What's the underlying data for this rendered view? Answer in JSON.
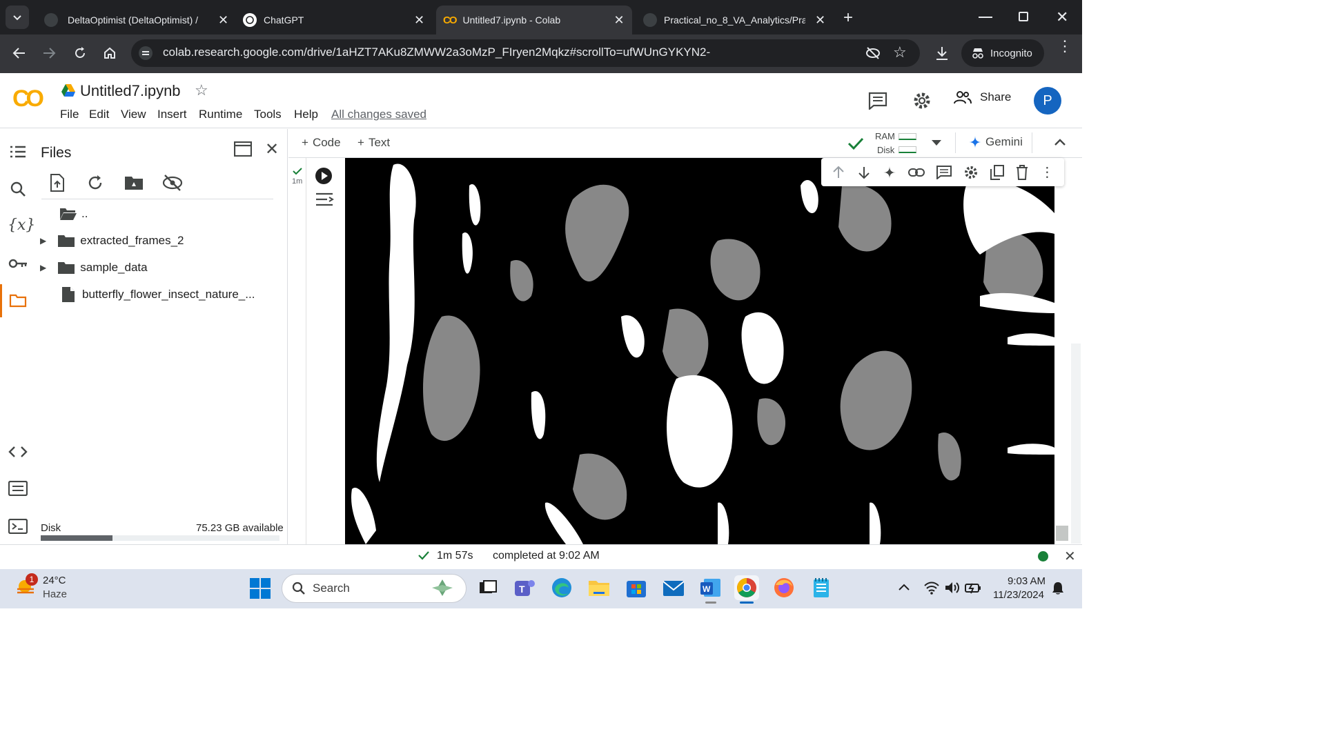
{
  "browser": {
    "tabs": [
      {
        "title": "DeltaOptimist (DeltaOptimist) /",
        "active": false
      },
      {
        "title": "ChatGPT",
        "active": false
      },
      {
        "title": "Untitled7.ipynb - Colab",
        "active": true
      },
      {
        "title": "Practical_no_8_VA_Analytics/Pra",
        "active": false
      }
    ],
    "url": "colab.research.google.com/drive/1aHZT7AKu8ZMWW2a3oMzP_FIryen2Mqkz#scrollTo=ufWUnGYKYN2-",
    "incognito_label": "Incognito"
  },
  "colab": {
    "logo_text": "CO",
    "notebook_title": "Untitled7.ipynb",
    "menu": [
      "File",
      "Edit",
      "View",
      "Insert",
      "Runtime",
      "Tools",
      "Help"
    ],
    "save_status": "All changes saved",
    "share_label": "Share",
    "avatar_initial": "P"
  },
  "files_panel": {
    "title": "Files",
    "parent_dir": "..",
    "items": [
      {
        "name": "extracted_frames_2",
        "type": "folder"
      },
      {
        "name": "sample_data",
        "type": "folder"
      },
      {
        "name": "butterfly_flower_insect_nature_...",
        "type": "file"
      }
    ],
    "disk_label": "Disk",
    "disk_available": "75.23 GB available",
    "disk_used_fraction": 0.3
  },
  "notebook_toolbar": {
    "add_code": "Code",
    "add_text": "Text",
    "ram_label": "RAM",
    "disk_label": "Disk",
    "gemini_label": "Gemini"
  },
  "cell": {
    "exec_time": "1m"
  },
  "status_bar": {
    "duration": "1m 57s",
    "completed": "completed at 9:02 AM"
  },
  "taskbar": {
    "weather_temp": "24°C",
    "weather_desc": "Haze",
    "weather_badge": "1",
    "search_placeholder": "Search",
    "time": "9:03 AM",
    "date": "11/23/2024"
  },
  "colors": {
    "chrome_dark": "#202124",
    "colab_orange": "#f9ab00",
    "accent_blue": "#1565c0",
    "success_green": "#188038"
  }
}
